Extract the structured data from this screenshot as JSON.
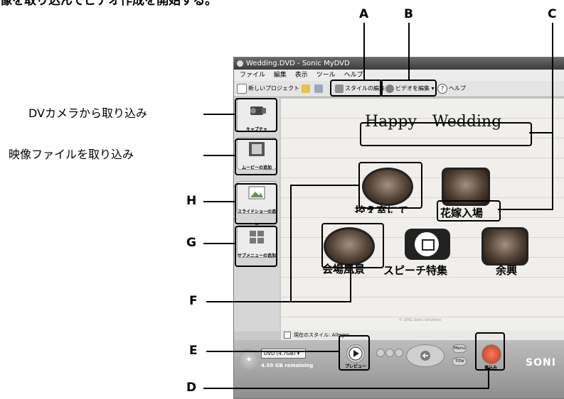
{
  "heading": "像を取り込んでビデオ作成を開始する。",
  "side_labels": {
    "dv_camera": "DVカメラから取り込み",
    "movie_file": "映像ファイルを取り込み"
  },
  "letters": {
    "a": "A",
    "b": "B",
    "c": "C",
    "d": "D",
    "e": "E",
    "f": "F",
    "g": "G",
    "h": "H"
  },
  "window": {
    "title": "Wedding.DVD - Sonic MyDVD",
    "menu": [
      "ファイル",
      "編集",
      "表示",
      "ツール",
      "ヘルプ"
    ],
    "toolbar": {
      "new_project": "新しいプロジェクト ▾",
      "edit_style": "スタイルの編集",
      "edit_video": "ビデオを編集 ▾",
      "help": "ヘルプ"
    },
    "left_panel": {
      "capture": "キャプチャ",
      "add_movie": "ムービーの追加",
      "add_slideshow": "スライドショーの追加",
      "add_submenu": "サブメニューの追加"
    },
    "menu_title": "Happy　Wedding",
    "thumbs": {
      "chapel": "控え室にて",
      "bride": "花嫁入場",
      "venue": "会場風景",
      "speech": "スピーチ特集",
      "entertainment": "余興"
    },
    "copyright": "© 2001 Sonic Solutions",
    "current_style": "現在のスタイル: Allegro",
    "footer": {
      "disc_type": "DVD (4.7GB)",
      "remaining": "4.59 GB remaining",
      "preview": "プレビュー",
      "menu_btn": "Menu",
      "title_btn": "Title",
      "burn": "書込み",
      "brand": "SONI"
    }
  }
}
